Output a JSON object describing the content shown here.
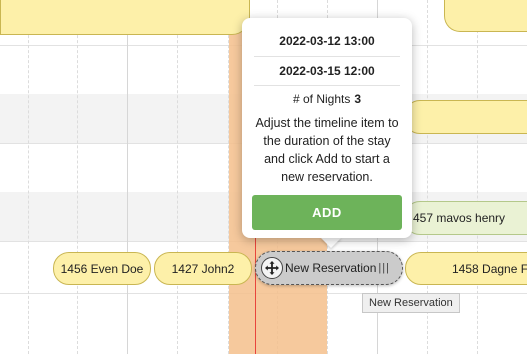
{
  "popover": {
    "start": "2022-03-12 13:00",
    "end": "2022-03-15 12:00",
    "nights_label": "# of Nights",
    "nights_value": "3",
    "instructions": "Adjust the timeline item to the duration of the stay and click Add to start a new reservation.",
    "add_label": "ADD"
  },
  "reservations": {
    "r1456": "1456 Even Doe",
    "r1427": "1427 John2",
    "r1458": "1458 Dagne F",
    "r457": "457 mavos henry"
  },
  "new_reservation": {
    "label": "New Reservation",
    "grip": "|||",
    "tooltip": "New Reservation"
  },
  "colors": {
    "selection": "#f4bf8c",
    "add_button": "#6db35a",
    "reservation": "#fdf0a9",
    "reservation_green": "#eaf2d4",
    "now_line": "#e8453c"
  }
}
